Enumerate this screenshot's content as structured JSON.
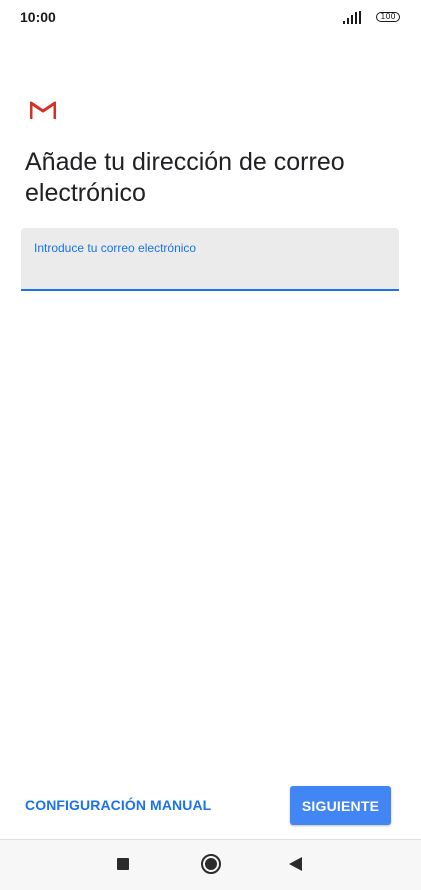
{
  "status_bar": {
    "time": "10:00",
    "battery": "100",
    "icons": [
      "signal-icon",
      "battery-icon"
    ]
  },
  "app": {
    "logo_icon": "gmail-icon",
    "title": "Añade tu dirección de correo electrónico"
  },
  "email_field": {
    "label": "Introduce tu correo electrónico",
    "value": ""
  },
  "actions": {
    "manual_config_label": "CONFIGURACIÓN MANUAL",
    "next_label": "SIGUIENTE"
  },
  "nav_bar": {
    "icons": [
      "recents-icon",
      "home-icon",
      "back-icon"
    ]
  },
  "colors": {
    "accent": "#1a73e8",
    "button": "#4285f4",
    "field_bg": "#ebebeb",
    "gmail_red": "#d93025"
  }
}
